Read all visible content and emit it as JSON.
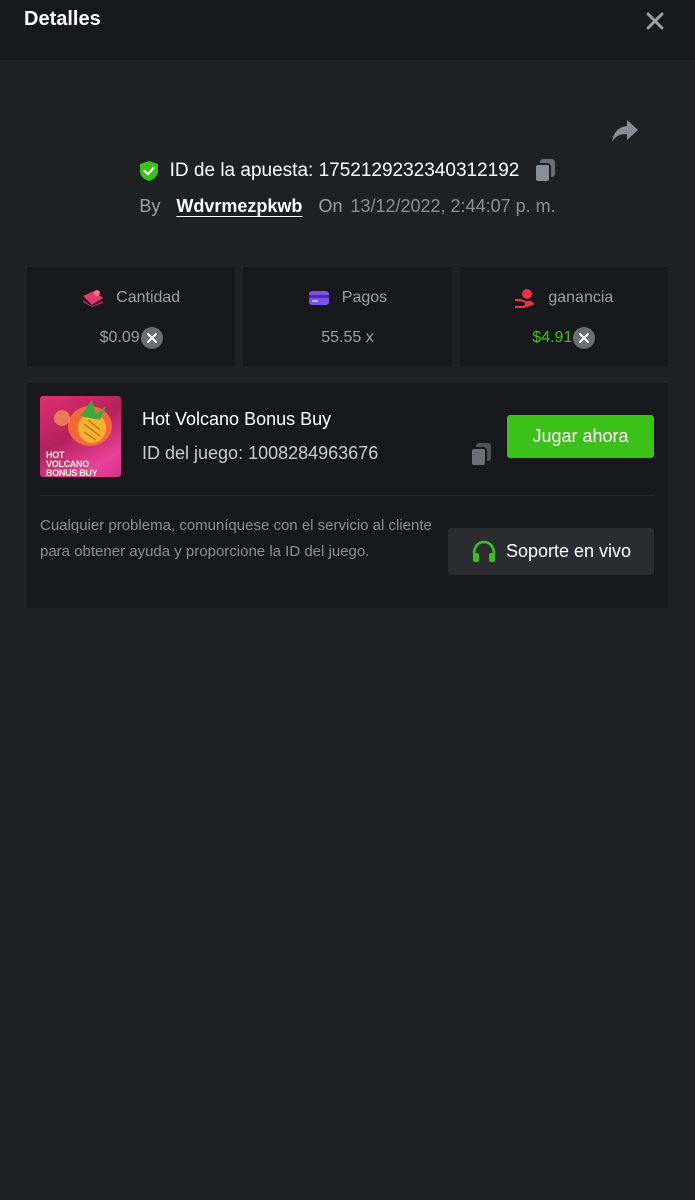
{
  "header": {
    "title": "Detalles"
  },
  "bet": {
    "id_label": "ID de la apuesta: 1752129232340312192",
    "by_label": "By",
    "username": "Wdvrmezpkwb",
    "on_label": "On",
    "datetime": "13/12/2022, 2:44:07 p. m."
  },
  "stats": {
    "amount": {
      "label": "Cantidad",
      "value": "$0.09",
      "icon": "bet-chip-icon"
    },
    "payout": {
      "label": "Pagos",
      "value": "55.55 x",
      "icon": "card-icon"
    },
    "profit": {
      "label": "ganancia",
      "value": "$4.91",
      "icon": "hand-money-icon"
    }
  },
  "game": {
    "name": "Hot Volcano Bonus Buy",
    "id_label": "ID del juego: 1008284963676",
    "thumbnail_text": "HOT VOLCANO BONUS BUY",
    "play_label": "Jugar ahora",
    "help_text": "Cualquier problema, comuníquese con el servicio al cliente para obtener ayuda y proporcione la ID del juego.",
    "support_label": "Soporte en vivo"
  },
  "colors": {
    "background": "#1f2024",
    "panel": "#17181b",
    "accent_green": "#3bc117",
    "muted_text": "#9aa0a6"
  }
}
